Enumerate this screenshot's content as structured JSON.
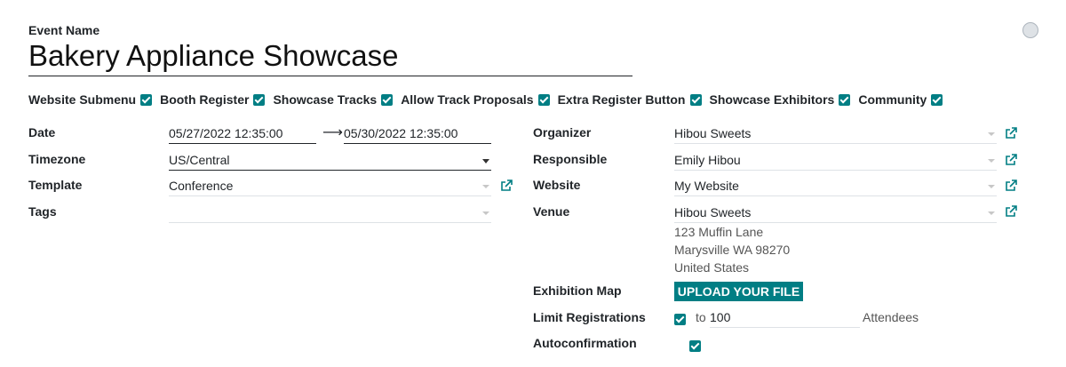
{
  "header": {
    "event_name_label": "Event Name",
    "event_name": "Bakery Appliance Showcase"
  },
  "options": [
    {
      "label": "Website Submenu",
      "checked": true
    },
    {
      "label": "Booth Register",
      "checked": true
    },
    {
      "label": "Showcase Tracks",
      "checked": true
    },
    {
      "label": "Allow Track Proposals",
      "checked": true
    },
    {
      "label": "Extra Register Button",
      "checked": true
    },
    {
      "label": "Showcase Exhibitors",
      "checked": true
    },
    {
      "label": "Community",
      "checked": true
    }
  ],
  "left": {
    "date_label": "Date",
    "date_start": "05/27/2022 12:35:00",
    "date_arrow": "⟶",
    "date_end": "05/30/2022 12:35:00",
    "timezone_label": "Timezone",
    "timezone": "US/Central",
    "template_label": "Template",
    "template": "Conference",
    "tags_label": "Tags",
    "tags": ""
  },
  "right": {
    "organizer_label": "Organizer",
    "organizer": "Hibou Sweets",
    "responsible_label": "Responsible",
    "responsible": "Emily Hibou",
    "website_label": "Website",
    "website": "My Website",
    "venue_label": "Venue",
    "venue": "Hibou Sweets",
    "venue_address": [
      "123 Muffin Lane",
      "Marysville WA 98270",
      "United States"
    ],
    "exhibition_map_label": "Exhibition Map",
    "upload_label": "UPLOAD YOUR FILE",
    "limit_label": "Limit Registrations",
    "limit_to": "to",
    "limit_value": "100",
    "attendees_label": "Attendees",
    "autoconfirm_label": "Autoconfirmation"
  },
  "colors": {
    "accent": "#017e84",
    "text": "#212529",
    "muted_border": "#dee2e6"
  },
  "icons": {
    "external_link": "external-link-icon",
    "dropdown": "caret-down-icon",
    "checkbox": "checkbox-checked-icon"
  }
}
